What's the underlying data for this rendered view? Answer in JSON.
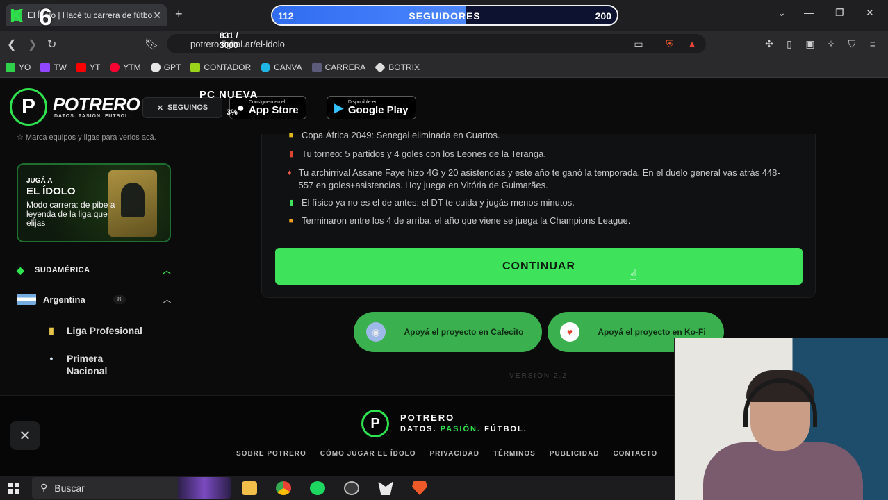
{
  "browser": {
    "tab_title": "El Ídolo | Hacé tu carrera de fútbol",
    "url": "potrerodigital.ar/el-idolo",
    "bookmarks": [
      "YO",
      "TW",
      "YT",
      "YTM",
      "GPT",
      "CONTADOR",
      "CANVA",
      "CARRERA",
      "BOTRIX"
    ]
  },
  "overlay": {
    "followers_current": "112",
    "followers_label": "SEGUIDORES",
    "followers_goal": "200",
    "followers_progress": 0.56,
    "number_badge": "6",
    "counter_top": "831 /",
    "counter_bottom": "3000",
    "pc_label": "PC NUEVA",
    "pc_percent": "3%"
  },
  "header": {
    "brand": "POTRERO",
    "tagline": "DATOS. PASIÓN. FÚTBOL.",
    "follow_label": "SEGUINOS",
    "appstore_small": "Consíguelo en el",
    "appstore_big": "App Store",
    "googleplay_small": "Disponible en",
    "googleplay_big": "Google Play"
  },
  "sidebar": {
    "hint": "Marca equipos y ligas para verlos acá.",
    "promo_kicker": "JUGÁ A",
    "promo_title": "EL ÍDOLO",
    "promo_desc": "Modo carrera: de pibe a leyenda de la liga que elijas",
    "section": "SUDAMÉRICA",
    "country": "Argentina",
    "country_count": "8",
    "leagues": [
      "Liga Profesional",
      "Primera Nacional"
    ]
  },
  "events": [
    {
      "icon": "flag",
      "color": "#e0b81c",
      "text": "Copa África 2049: Senegal eliminada en Cuartos."
    },
    {
      "icon": "trophy",
      "color": "#e0452f",
      "text": "Tu torneo: 5 partidos y 4 goles con los Leones de la Teranga."
    },
    {
      "icon": "rival",
      "color": "#e85a4a",
      "text": "Tu archirrival Assane Faye hizo 4G y 20 asistencias y este año te ganó la temporada. En el duelo general vas atrás 448-557 en goles+asistencias. Hoy juega en Vitória de Guimarães."
    },
    {
      "icon": "battery",
      "color": "#3fe35b",
      "text": "El físico ya no es el de antes: el DT te cuida y jugás menos minutos."
    },
    {
      "icon": "champions",
      "color": "#f0a020",
      "text": "Terminaron entre los 4 de arriba: el año que viene se juega la Champions League."
    }
  ],
  "main": {
    "continue_label": "CONTINUAR",
    "support_cafecito": "Apoyá el proyecto en Cafecito",
    "support_kofi": "Apoyá el proyecto en Ko-Fi",
    "version": "VERSIÓN 2.2"
  },
  "footer": {
    "brand": "POTRERO",
    "slogan_a": "DATOS. ",
    "slogan_b": "PASIÓN.",
    "slogan_c": " FÚTBOL.",
    "links": [
      "SOBRE POTRERO",
      "CÓMO JUGAR EL ÍDOLO",
      "PRIVACIDAD",
      "TÉRMINOS",
      "PUBLICIDAD",
      "CONTACTO"
    ]
  },
  "taskbar": {
    "search_placeholder": "Buscar"
  }
}
